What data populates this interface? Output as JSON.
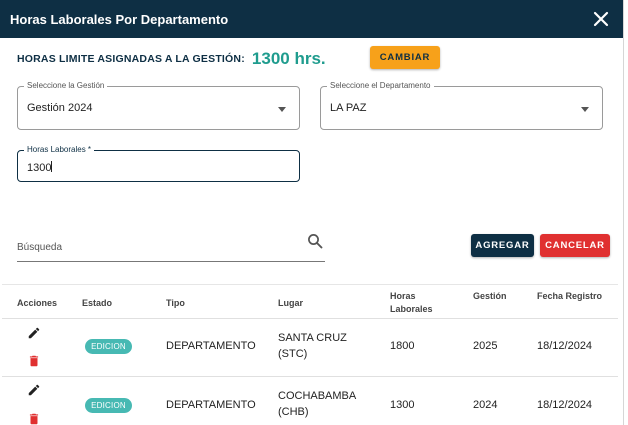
{
  "dialog": {
    "title": "Horas Laborales Por Departamento",
    "close_icon": "close-icon"
  },
  "limit": {
    "label": "HORAS LIMITE ASIGNADAS A LA GESTIÓN:",
    "value": "1300 hrs.",
    "change_label": "CAMBIAR"
  },
  "form": {
    "gestion": {
      "label": "Seleccione la Gestión",
      "value": "Gestión 2024"
    },
    "departamento": {
      "label": "Seleccione el Departamento",
      "value": "LA PAZ"
    },
    "horas": {
      "label": "Horas Laborales *",
      "value": "1300"
    }
  },
  "search": {
    "placeholder": "Búsqueda",
    "icon": "search-icon"
  },
  "actions": {
    "add_label": "AGREGAR",
    "cancel_label": "CANCELAR"
  },
  "table": {
    "headers": {
      "acciones": "Acciones",
      "estado": "Estado",
      "tipo": "Tipo",
      "lugar": "Lugar",
      "horas_l1": "Horas",
      "horas_l2": "Laborales",
      "gestion": "Gestión",
      "fecha": "Fecha Registro"
    },
    "rows": [
      {
        "estado": "EDICION",
        "tipo": "DEPARTAMENTO",
        "lugar_l1": "SANTA CRUZ",
        "lugar_l2": "(STC)",
        "horas": "1800",
        "gestion": "2025",
        "fecha": "18/12/2024"
      },
      {
        "estado": "EDICION",
        "tipo": "DEPARTAMENTO",
        "lugar_l1": "COCHABAMBA",
        "lugar_l2": "(CHB)",
        "horas": "1300",
        "gestion": "2024",
        "fecha": "18/12/2024"
      }
    ]
  },
  "colors": {
    "header": "#0e2f44",
    "accent_teal": "#1f9c8e",
    "orange": "#f7a11a",
    "danger": "#e03030",
    "badge": "#47b9b3"
  }
}
